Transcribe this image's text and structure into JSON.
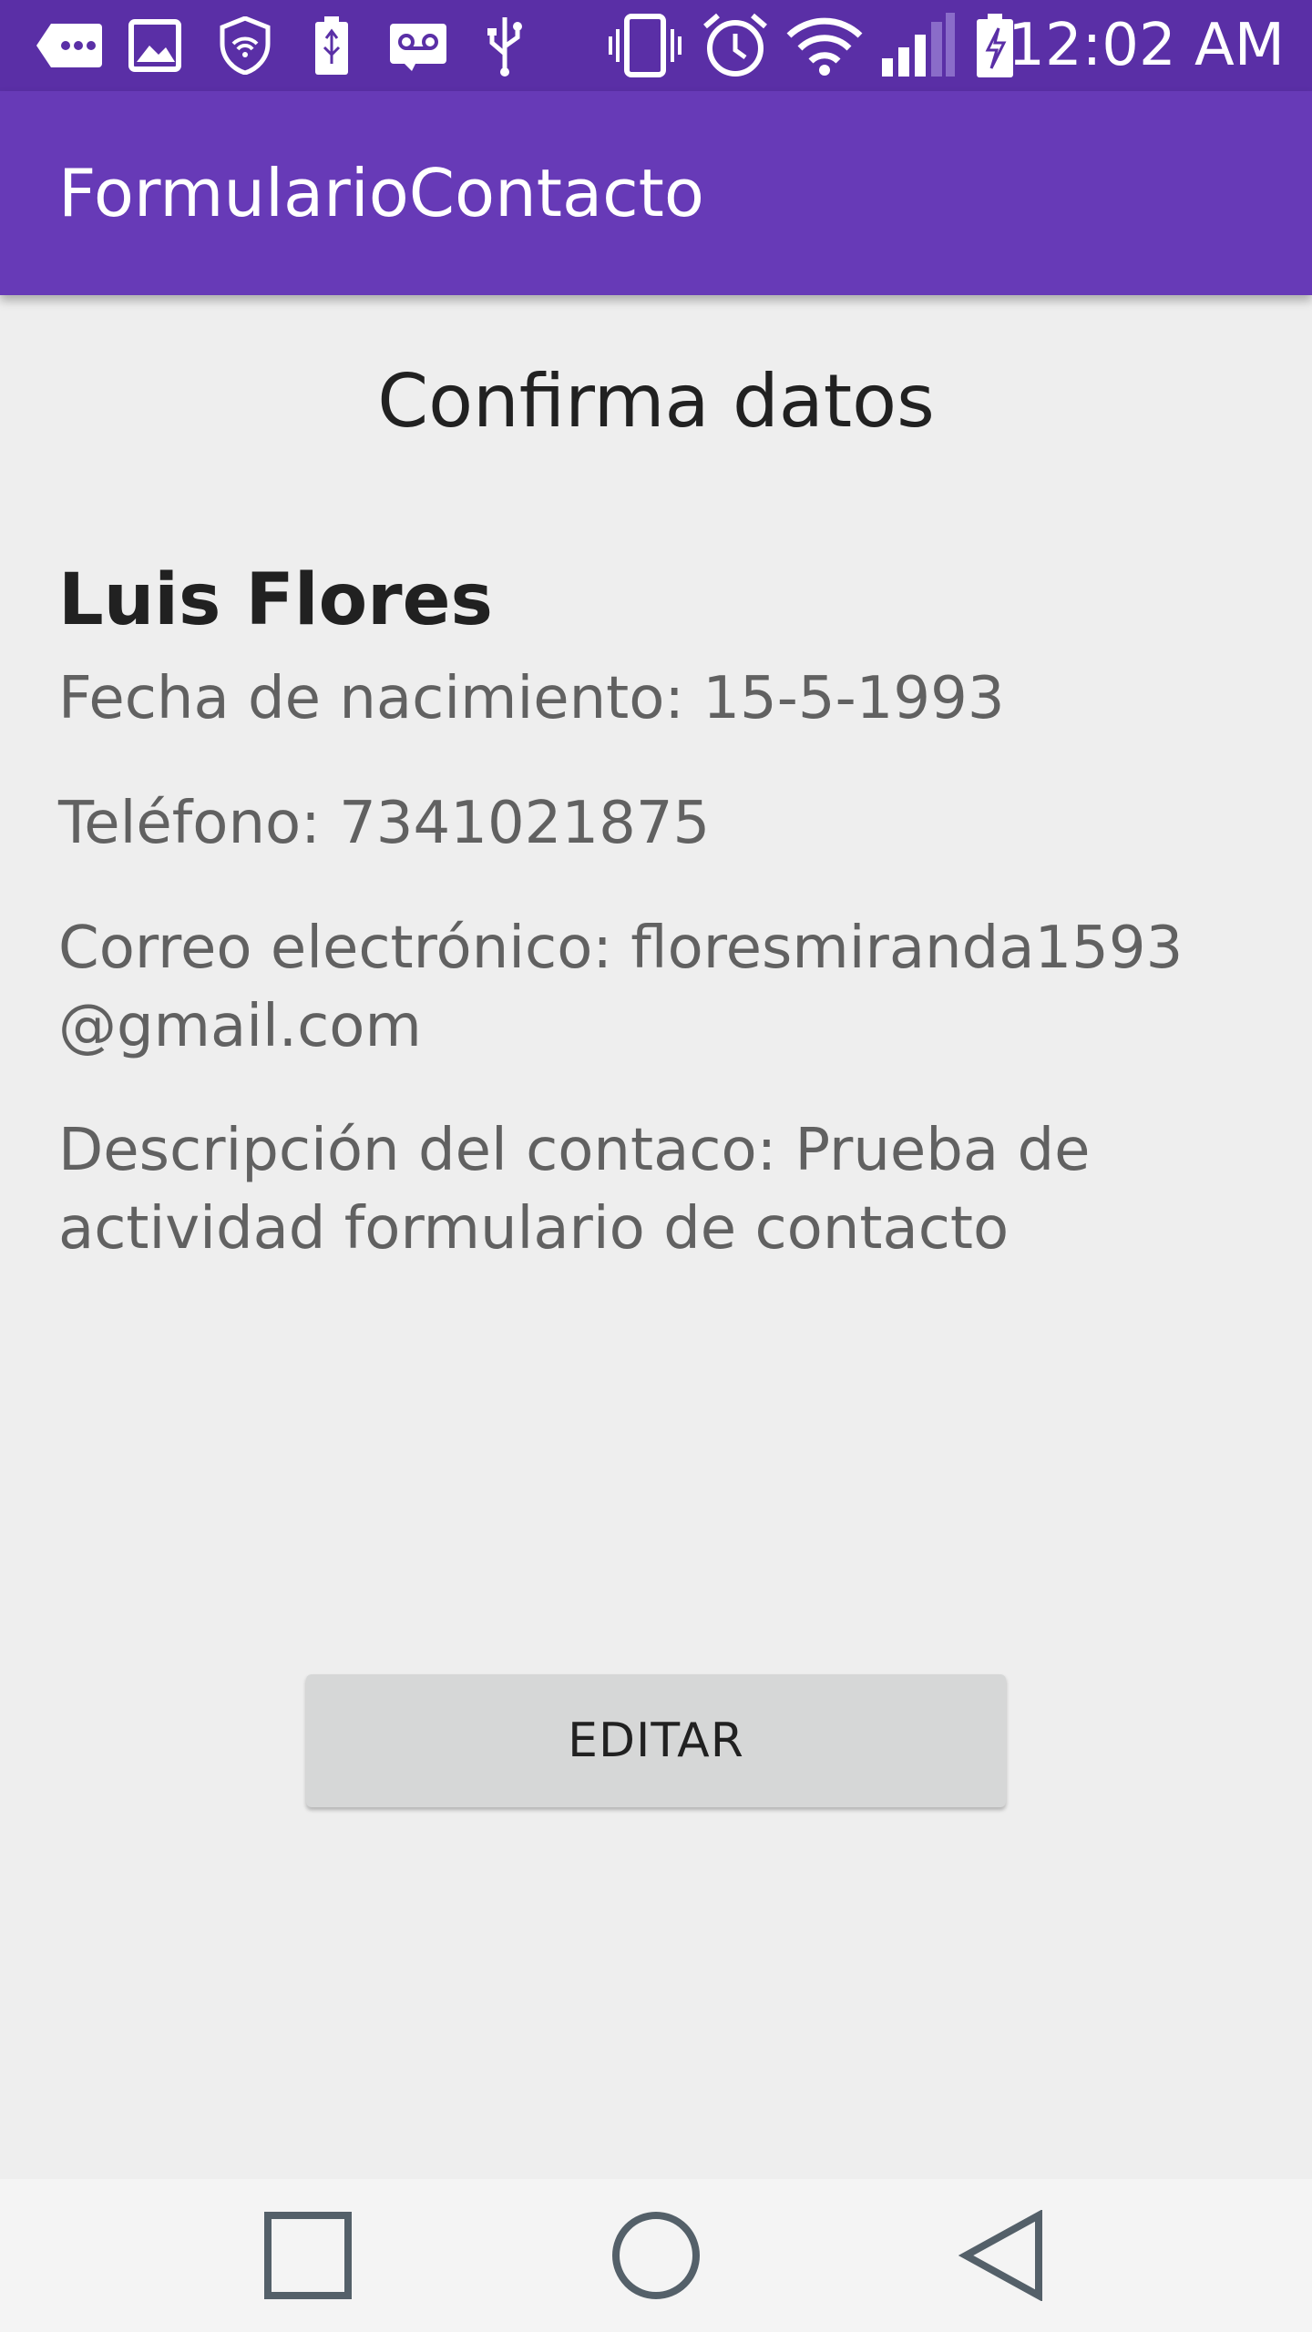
{
  "status_bar": {
    "time": "12:02 AM",
    "icons": [
      "more-notifications-icon",
      "image-icon",
      "vpn-shield-icon",
      "usb-battery-icon",
      "voicemail-icon",
      "usb-icon",
      "vibrate-icon",
      "alarm-icon",
      "wifi-icon",
      "signal-icon",
      "battery-charging-icon"
    ]
  },
  "app_bar": {
    "title": "FormularioContacto"
  },
  "content": {
    "heading": "Confirma datos",
    "name": "Luis Flores",
    "birth_date": "Fecha de nacimiento: 15-5-1993",
    "phone": "Teléfono: 7341021875",
    "email_line1": "Correo electrónico: floresmiranda1593",
    "email_line2": "@gmail.com",
    "description_line1": "Descripción del contaco: Prueba de",
    "description_line2": "actividad formulario de contacto"
  },
  "edit_button": {
    "label": "EDITAR"
  },
  "nav_bar": {
    "buttons": [
      "recents-icon",
      "home-icon",
      "back-icon"
    ]
  },
  "colors": {
    "status_bar": "#5a2fa6",
    "app_bar": "#673ab7",
    "background": "#eeeeee",
    "button": "#d6d7d7"
  }
}
